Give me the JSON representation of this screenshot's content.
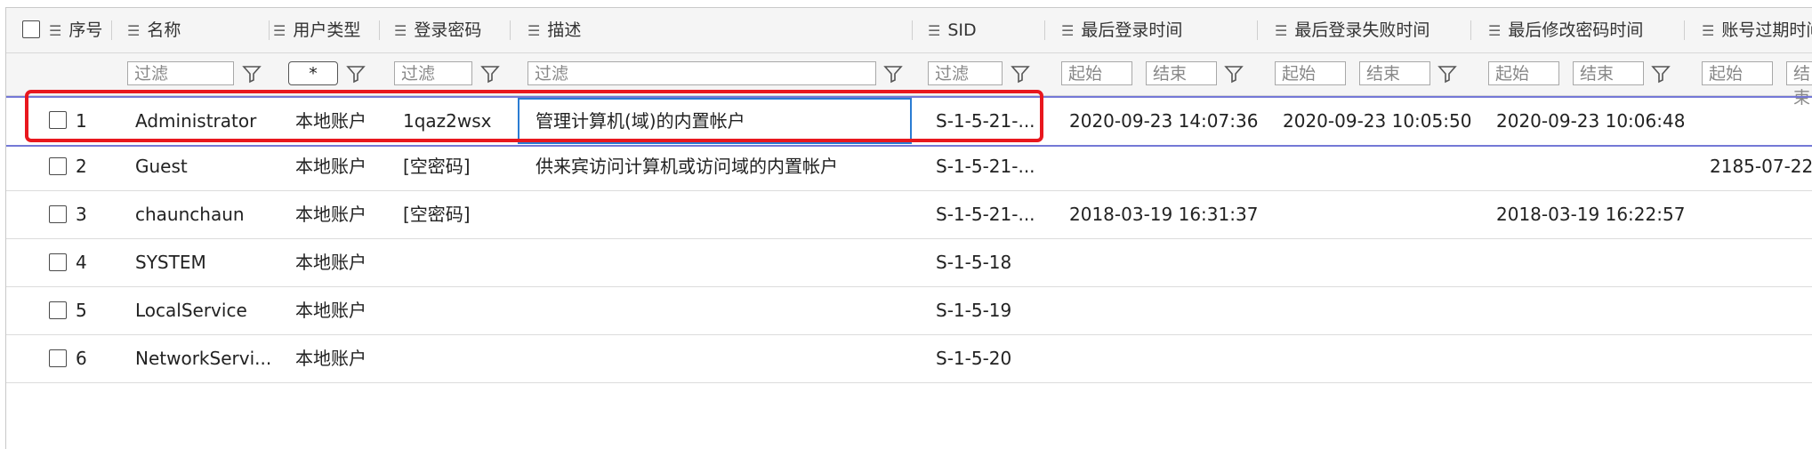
{
  "columns": {
    "index": "序号",
    "name": "名称",
    "user_type": "用户类型",
    "password": "登录密码",
    "description": "描述",
    "sid": "SID",
    "last_login": "最后登录时间",
    "last_login_fail": "最后登录失败时间",
    "last_pwd_change": "最后修改密码时间",
    "expire": "账号过期时间"
  },
  "filters": {
    "filter_placeholder": "过滤",
    "start_label": "起始",
    "end_label": "结束",
    "user_type_value": "*"
  },
  "rows": [
    {
      "index": "1",
      "name": "Administrator",
      "user_type": "本地账户",
      "password": "1qaz2wsx",
      "description": "管理计算机(域)的内置帐户",
      "sid": "S-1-5-21-...",
      "last_login": "2020-09-23 14:07:36",
      "last_login_fail": "2020-09-23 10:05:50",
      "last_pwd_change": "2020-09-23 10:06:48",
      "expire": ""
    },
    {
      "index": "2",
      "name": "Guest",
      "user_type": "本地账户",
      "password": "[空密码]",
      "description": "供来宾访问计算机或访问域的内置帐户",
      "sid": "S-1-5-21-...",
      "last_login": "",
      "last_login_fail": "",
      "last_pwd_change": "",
      "expire": "2185-07-22"
    },
    {
      "index": "3",
      "name": "chaunchaun",
      "user_type": "本地账户",
      "password": "[空密码]",
      "description": "",
      "sid": "S-1-5-21-...",
      "last_login": "2018-03-19 16:31:37",
      "last_login_fail": "",
      "last_pwd_change": "2018-03-19 16:22:57",
      "expire": ""
    },
    {
      "index": "4",
      "name": "SYSTEM",
      "user_type": "本地账户",
      "password": "",
      "description": "",
      "sid": "S-1-5-18",
      "last_login": "",
      "last_login_fail": "",
      "last_pwd_change": "",
      "expire": ""
    },
    {
      "index": "5",
      "name": "LocalService",
      "user_type": "本地账户",
      "password": "",
      "description": "",
      "sid": "S-1-5-19",
      "last_login": "",
      "last_login_fail": "",
      "last_pwd_change": "",
      "expire": ""
    },
    {
      "index": "6",
      "name": "NetworkServi...",
      "user_type": "本地账户",
      "password": "",
      "description": "",
      "sid": "S-1-5-20",
      "last_login": "",
      "last_login_fail": "",
      "last_pwd_change": "",
      "expire": ""
    }
  ],
  "colors": {
    "highlight_frame": "#e8171e",
    "selected_row_line": "#7478d6",
    "edit_border": "#2b7cd3"
  }
}
